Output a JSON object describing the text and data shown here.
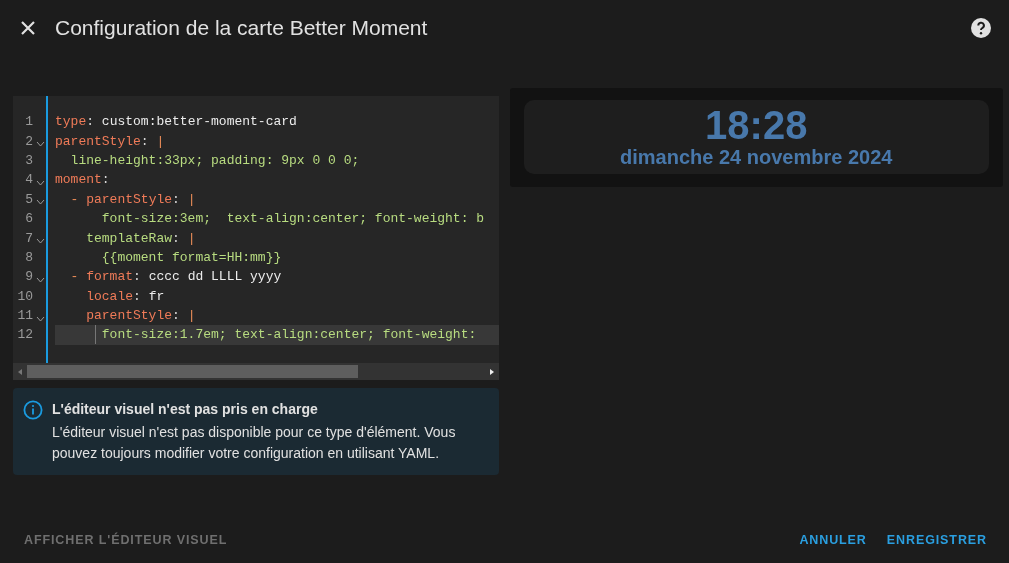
{
  "dialog": {
    "title": "Configuration de la carte Better Moment"
  },
  "editor": {
    "lines": [
      {
        "number": "1",
        "foldable": false,
        "active": false,
        "tokens": [
          {
            "kind": "key",
            "text": "type"
          },
          {
            "kind": "punct",
            "text": ": "
          },
          {
            "kind": "plain",
            "text": "custom:better-moment-card"
          }
        ]
      },
      {
        "number": "2",
        "foldable": true,
        "active": false,
        "tokens": [
          {
            "kind": "key",
            "text": "parentStyle"
          },
          {
            "kind": "punct",
            "text": ": "
          },
          {
            "kind": "marker",
            "text": "|"
          }
        ]
      },
      {
        "number": "3",
        "foldable": false,
        "active": false,
        "tokens": [
          {
            "kind": "string",
            "text": "  line-height:33px; padding: 9px 0 0 0;"
          }
        ]
      },
      {
        "number": "4",
        "foldable": true,
        "active": false,
        "tokens": [
          {
            "kind": "key",
            "text": "moment"
          },
          {
            "kind": "punct",
            "text": ":"
          }
        ]
      },
      {
        "number": "5",
        "foldable": true,
        "active": false,
        "tokens": [
          {
            "kind": "marker",
            "text": "  - "
          },
          {
            "kind": "key",
            "text": "parentStyle"
          },
          {
            "kind": "punct",
            "text": ": "
          },
          {
            "kind": "marker",
            "text": "|"
          }
        ]
      },
      {
        "number": "6",
        "foldable": false,
        "active": false,
        "tokens": [
          {
            "kind": "string",
            "text": "      font-size:3em;  text-align:center; font-weight: b"
          }
        ]
      },
      {
        "number": "7",
        "foldable": true,
        "active": false,
        "tokens": [
          {
            "kind": "string",
            "text": "    templateRaw"
          },
          {
            "kind": "punct",
            "text": ": "
          },
          {
            "kind": "marker",
            "text": "|"
          }
        ]
      },
      {
        "number": "8",
        "foldable": false,
        "active": false,
        "tokens": [
          {
            "kind": "string",
            "text": "      {{moment format=HH:mm}}"
          }
        ]
      },
      {
        "number": "9",
        "foldable": true,
        "active": false,
        "tokens": [
          {
            "kind": "marker",
            "text": "  - "
          },
          {
            "kind": "key",
            "text": "format"
          },
          {
            "kind": "punct",
            "text": ": "
          },
          {
            "kind": "plain",
            "text": "cccc dd LLLL yyyy"
          }
        ]
      },
      {
        "number": "10",
        "foldable": false,
        "active": false,
        "tokens": [
          {
            "kind": "key",
            "text": "    locale"
          },
          {
            "kind": "punct",
            "text": ": "
          },
          {
            "kind": "plain",
            "text": "fr"
          }
        ]
      },
      {
        "number": "11",
        "foldable": true,
        "active": false,
        "tokens": [
          {
            "kind": "key",
            "text": "    parentStyle"
          },
          {
            "kind": "punct",
            "text": ": "
          },
          {
            "kind": "marker",
            "text": "|"
          }
        ]
      },
      {
        "number": "12",
        "foldable": false,
        "active": true,
        "tokens": [
          {
            "kind": "string",
            "text": "      font-size:1.7em; text-align:center; font-weight:"
          }
        ]
      }
    ]
  },
  "notice": {
    "title": "L'éditeur visuel n'est pas pris en charge",
    "body": "L'éditeur visuel n'est pas disponible pour ce type d'élément. Vous pouvez toujours modifier votre configuration en utilisant YAML."
  },
  "preview": {
    "time": "18:28",
    "date": "dimanche 24 novembre 2024"
  },
  "footer": {
    "toggle": "AFFICHER L'ÉDITEUR VISUEL",
    "buttons": [
      "ANNULER",
      "ENREGISTRER"
    ]
  }
}
